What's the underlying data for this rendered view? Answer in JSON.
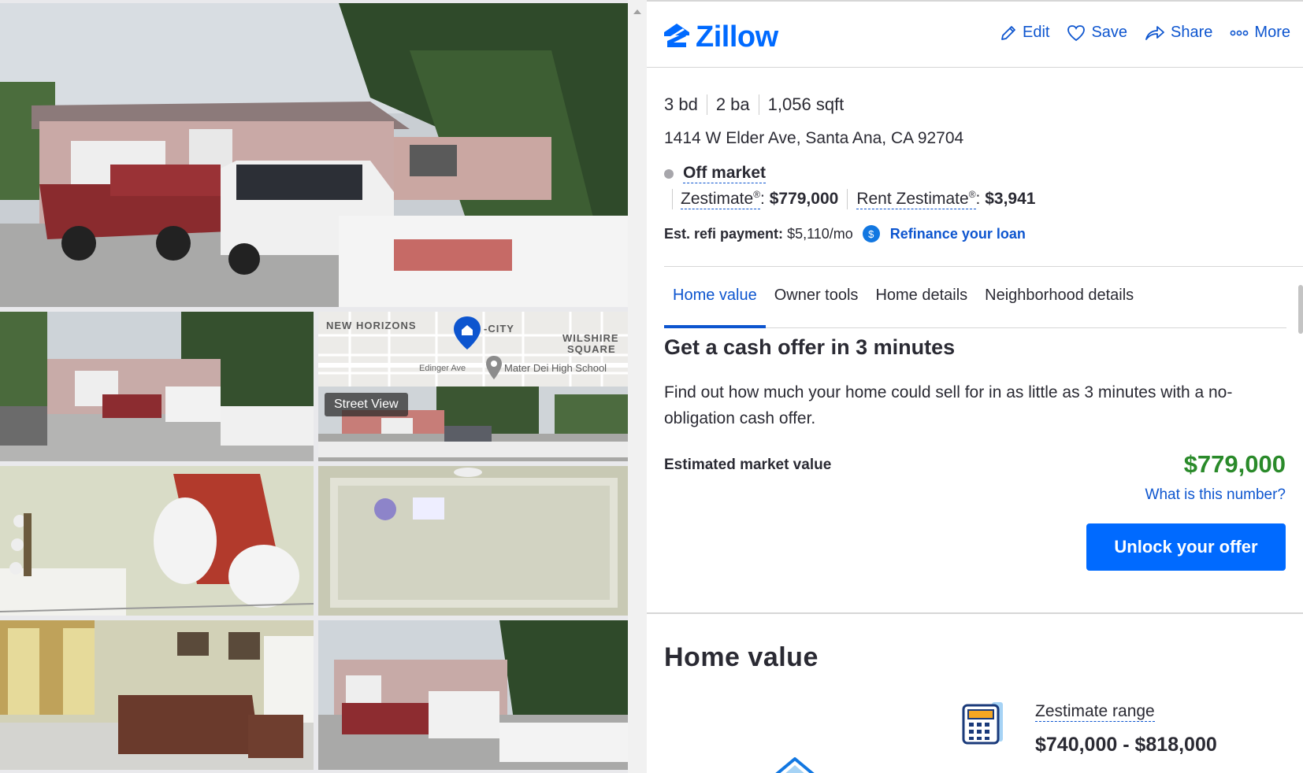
{
  "gallery": {
    "street_view_label": "Street View",
    "map": {
      "label_neighborhood": "NEW HORIZONS",
      "label_city": "-CITY",
      "label_wilshire_1": "WILSHIRE",
      "label_wilshire_2": "SQUARE",
      "label_street": "Edinger Ave",
      "label_school": "Mater Dei High School"
    }
  },
  "header": {
    "logo": "Zillow",
    "actions": {
      "edit": "Edit",
      "save": "Save",
      "share": "Share",
      "more": "More"
    }
  },
  "property": {
    "beds": "3 bd",
    "baths": "2 ba",
    "sqft": "1,056 sqft",
    "address": "1414 W Elder Ave, Santa Ana, CA 92704",
    "status": "Off market",
    "zestimate_label": "Zestimate",
    "zestimate_value": "$779,000",
    "rent_zestimate_label": "Rent Zestimate",
    "rent_zestimate_value": "$3,941",
    "refi_label": "Est. refi payment:",
    "refi_value": "$5,110/mo",
    "refi_icon": "$",
    "refi_link": "Refinance your loan"
  },
  "tabs": [
    {
      "label": "Home value",
      "active": true
    },
    {
      "label": "Owner tools",
      "active": false
    },
    {
      "label": "Home details",
      "active": false
    },
    {
      "label": "Neighborhood details",
      "active": false
    }
  ],
  "offer": {
    "title": "Get a cash offer in 3 minutes",
    "description": "Find out how much your home could sell for in as little as 3 minutes with a no-obligation cash offer.",
    "emv_label": "Estimated market value",
    "emv_value": "$779,000",
    "emv_link": "What is this number?",
    "cta": "Unlock your offer"
  },
  "home_value": {
    "title": "Home value",
    "range_label": "Zestimate range",
    "range_value": "$740,000 - $818,000"
  },
  "colors": {
    "brand_blue": "#006aff",
    "link_blue": "#0d55cf",
    "value_green": "#2a8a2a",
    "status_gray": "#a7a6ab"
  },
  "icons": [
    "zillow-logo-icon",
    "pencil-icon",
    "heart-icon",
    "share-arrow-icon",
    "more-dots-icon",
    "dollar-circle-icon",
    "calculator-icon",
    "map-pin-icon",
    "house-icon"
  ]
}
